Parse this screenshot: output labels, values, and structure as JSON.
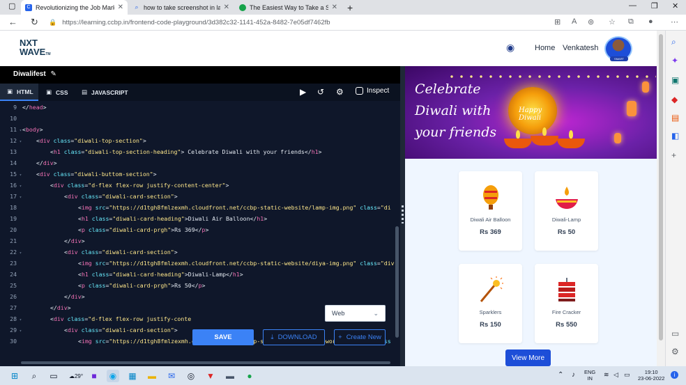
{
  "browser": {
    "tabs": [
      {
        "title": "Revolutionizing the Job Market |",
        "active": true,
        "favicon": "ccbp-icon",
        "color": "#2563eb"
      },
      {
        "title": "how to take screenshot in laptop",
        "active": false,
        "favicon": "search-icon",
        "color": "#2563eb"
      },
      {
        "title": "The Easiest Way to Take a Scree",
        "active": false,
        "favicon": "green-circle-icon",
        "color": "#16a34a"
      }
    ],
    "new_tab": "+",
    "url": "https://learning.ccbp.in/frontend-code-playground/3d382c32-1141-452a-8482-7e05df7462fb"
  },
  "site": {
    "logo_line1": "NXT",
    "logo_line2": "WAVE",
    "logo_tm": "TM",
    "nav_home": "Home",
    "user_name": "Venkatesh",
    "avatar_badge": "SMART"
  },
  "editor": {
    "project_name": "Diwalifest",
    "tabs": [
      {
        "label": "HTML",
        "active": true,
        "icon": "html5-icon"
      },
      {
        "label": "CSS",
        "active": false,
        "icon": "css3-icon"
      },
      {
        "label": "JAVASCRIPT",
        "active": false,
        "icon": "javascript-icon"
      }
    ],
    "inspect_label": "Inspect",
    "lines": [
      {
        "n": "9",
        "fold": false,
        "indent": 0,
        "parts": [
          [
            "p",
            "</"
          ],
          [
            "t",
            "head"
          ],
          [
            "p",
            ">"
          ]
        ]
      },
      {
        "n": "10",
        "fold": false,
        "indent": 0,
        "parts": []
      },
      {
        "n": "11",
        "fold": true,
        "indent": 0,
        "parts": [
          [
            "p",
            "<"
          ],
          [
            "t",
            "body"
          ],
          [
            "p",
            ">"
          ]
        ]
      },
      {
        "n": "12",
        "fold": true,
        "indent": 1,
        "parts": [
          [
            "p",
            "<"
          ],
          [
            "t",
            "div"
          ],
          [
            "p",
            " "
          ],
          [
            "a",
            "class"
          ],
          [
            "p",
            "="
          ],
          [
            "s",
            "\"diwali-top-section\""
          ],
          [
            "p",
            ">"
          ]
        ]
      },
      {
        "n": "13",
        "fold": false,
        "indent": 2,
        "parts": [
          [
            "p",
            "<"
          ],
          [
            "t",
            "h1"
          ],
          [
            "p",
            " "
          ],
          [
            "a",
            "class"
          ],
          [
            "p",
            "="
          ],
          [
            "s",
            "\"diwali-top-section-heading\""
          ],
          [
            "p",
            "> Celebrate Diwali with your friends</"
          ],
          [
            "t",
            "h1"
          ],
          [
            "p",
            ">"
          ]
        ]
      },
      {
        "n": "14",
        "fold": false,
        "indent": 1,
        "parts": [
          [
            "p",
            "</"
          ],
          [
            "t",
            "div"
          ],
          [
            "p",
            ">"
          ]
        ]
      },
      {
        "n": "15",
        "fold": true,
        "indent": 1,
        "parts": [
          [
            "p",
            "<"
          ],
          [
            "t",
            "div"
          ],
          [
            "p",
            " "
          ],
          [
            "a",
            "class"
          ],
          [
            "p",
            "="
          ],
          [
            "s",
            "\"diwali-buttom-section\""
          ],
          [
            "p",
            ">"
          ]
        ]
      },
      {
        "n": "16",
        "fold": true,
        "indent": 2,
        "parts": [
          [
            "p",
            "<"
          ],
          [
            "t",
            "div"
          ],
          [
            "p",
            " "
          ],
          [
            "a",
            "class"
          ],
          [
            "p",
            "="
          ],
          [
            "s",
            "\"d-flex flex-row justify-content-center\""
          ],
          [
            "p",
            ">"
          ]
        ]
      },
      {
        "n": "17",
        "fold": true,
        "indent": 3,
        "parts": [
          [
            "p",
            "<"
          ],
          [
            "t",
            "div"
          ],
          [
            "p",
            " "
          ],
          [
            "a",
            "class"
          ],
          [
            "p",
            "="
          ],
          [
            "s",
            "\"diwali-card-section\""
          ],
          [
            "p",
            ">"
          ]
        ]
      },
      {
        "n": "18",
        "fold": false,
        "indent": 4,
        "parts": [
          [
            "p",
            "<"
          ],
          [
            "t",
            "img"
          ],
          [
            "p",
            " "
          ],
          [
            "a",
            "src"
          ],
          [
            "p",
            "="
          ],
          [
            "s",
            "\"https://d1tgh8fmlzexmh.cloudfront.net/ccbp-static-website/lamp-img.png\""
          ],
          [
            "p",
            " "
          ],
          [
            "a",
            "class"
          ],
          [
            "p",
            "="
          ],
          [
            "s",
            "\"di"
          ]
        ]
      },
      {
        "n": "19",
        "fold": false,
        "indent": 4,
        "parts": [
          [
            "p",
            "<"
          ],
          [
            "t",
            "h1"
          ],
          [
            "p",
            " "
          ],
          [
            "a",
            "class"
          ],
          [
            "p",
            "="
          ],
          [
            "s",
            "\"diwali-card-heading\""
          ],
          [
            "p",
            ">Diwali Air Balloon</"
          ],
          [
            "t",
            "h1"
          ],
          [
            "p",
            ">"
          ]
        ]
      },
      {
        "n": "20",
        "fold": false,
        "indent": 4,
        "parts": [
          [
            "p",
            "<"
          ],
          [
            "t",
            "p"
          ],
          [
            "p",
            " "
          ],
          [
            "a",
            "class"
          ],
          [
            "p",
            "="
          ],
          [
            "s",
            "\"diwali-card-prgh\""
          ],
          [
            "p",
            ">Rs 369</"
          ],
          [
            "t",
            "p"
          ],
          [
            "p",
            ">"
          ]
        ]
      },
      {
        "n": "21",
        "fold": false,
        "indent": 3,
        "parts": [
          [
            "p",
            "</"
          ],
          [
            "t",
            "div"
          ],
          [
            "p",
            ">"
          ]
        ]
      },
      {
        "n": "22",
        "fold": true,
        "indent": 3,
        "parts": [
          [
            "p",
            "<"
          ],
          [
            "t",
            "div"
          ],
          [
            "p",
            " "
          ],
          [
            "a",
            "class"
          ],
          [
            "p",
            "="
          ],
          [
            "s",
            "\"diwali-card-section\""
          ],
          [
            "p",
            ">"
          ]
        ]
      },
      {
        "n": "23",
        "fold": false,
        "indent": 4,
        "parts": [
          [
            "p",
            "<"
          ],
          [
            "t",
            "img"
          ],
          [
            "p",
            " "
          ],
          [
            "a",
            "src"
          ],
          [
            "p",
            "="
          ],
          [
            "s",
            "\"https://d1tgh8fmlzexmh.cloudfront.net/ccbp-static-website/diya-img.png\""
          ],
          [
            "p",
            " "
          ],
          [
            "a",
            "class"
          ],
          [
            "p",
            "="
          ],
          [
            "s",
            "\"div"
          ]
        ]
      },
      {
        "n": "24",
        "fold": false,
        "indent": 4,
        "parts": [
          [
            "p",
            "<"
          ],
          [
            "t",
            "h1"
          ],
          [
            "p",
            " "
          ],
          [
            "a",
            "class"
          ],
          [
            "p",
            "="
          ],
          [
            "s",
            "\"diwali-card-heading\""
          ],
          [
            "p",
            ">Diwali-Lamp</"
          ],
          [
            "t",
            "h1"
          ],
          [
            "p",
            ">"
          ]
        ]
      },
      {
        "n": "25",
        "fold": false,
        "indent": 4,
        "parts": [
          [
            "p",
            "<"
          ],
          [
            "t",
            "p"
          ],
          [
            "p",
            " "
          ],
          [
            "a",
            "class"
          ],
          [
            "p",
            "="
          ],
          [
            "s",
            "\"diwali-card-prgh\""
          ],
          [
            "p",
            ">Rs 50</"
          ],
          [
            "t",
            "p"
          ],
          [
            "p",
            ">"
          ]
        ]
      },
      {
        "n": "26",
        "fold": false,
        "indent": 3,
        "parts": [
          [
            "p",
            "</"
          ],
          [
            "t",
            "div"
          ],
          [
            "p",
            ">"
          ]
        ]
      },
      {
        "n": "27",
        "fold": false,
        "indent": 2,
        "parts": [
          [
            "p",
            "</"
          ],
          [
            "t",
            "div"
          ],
          [
            "p",
            ">"
          ]
        ]
      },
      {
        "n": "28",
        "fold": true,
        "indent": 2,
        "parts": [
          [
            "p",
            "<"
          ],
          [
            "t",
            "div"
          ],
          [
            "p",
            " "
          ],
          [
            "a",
            "class"
          ],
          [
            "p",
            "="
          ],
          [
            "s",
            "\"d-flex flex-row justify-conte"
          ]
        ]
      },
      {
        "n": "29",
        "fold": true,
        "indent": 3,
        "parts": [
          [
            "p",
            "<"
          ],
          [
            "t",
            "div"
          ],
          [
            "p",
            " "
          ],
          [
            "a",
            "class"
          ],
          [
            "p",
            "="
          ],
          [
            "s",
            "\"diwali-card-section\""
          ],
          [
            "p",
            ">"
          ]
        ]
      },
      {
        "n": "30",
        "fold": false,
        "indent": 4,
        "parts": [
          [
            "p",
            "<"
          ],
          [
            "t",
            "img"
          ],
          [
            "p",
            " "
          ],
          [
            "a",
            "src"
          ],
          [
            "p",
            "="
          ],
          [
            "s",
            "\"https://d1tgh8fmlzexmh.cloudfront.net/ccbp-static-website/firework-img.png\""
          ],
          [
            "p",
            " "
          ],
          [
            "a",
            "class"
          ]
        ]
      }
    ],
    "device_select": "Web",
    "save_label": "SAVE",
    "download_label": "DOWNLOAD",
    "create_new_label": "Create New"
  },
  "preview": {
    "heading": "Celebrate Diwali with your friends",
    "lamp_label": "Happy Diwali",
    "cards": [
      {
        "heading": "Diwali Air Balloon",
        "price": "Rs 369",
        "icon": "air-balloon-icon"
      },
      {
        "heading": "Diwali-Lamp",
        "price": "Rs 50",
        "icon": "diya-lamp-icon"
      },
      {
        "heading": "Sparklers",
        "price": "Rs 150",
        "icon": "sparkler-icon"
      },
      {
        "heading": "Fire Cracker",
        "price": "Rs 550",
        "icon": "fire-cracker-icon"
      }
    ],
    "view_more": "View More"
  },
  "taskbar": {
    "weather": "29°",
    "lang_line1": "ENG",
    "lang_line2": "IN",
    "time": "19:10",
    "date": "23-06-2022"
  }
}
